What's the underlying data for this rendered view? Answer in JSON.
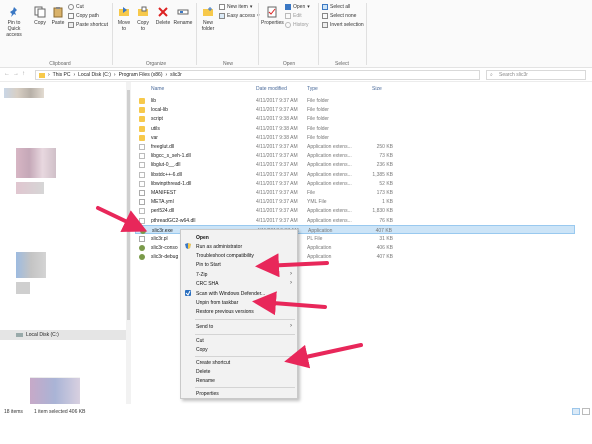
{
  "ribbon": {
    "clipboard": {
      "group_label": "Clipboard",
      "pin_label": "Pin to Quick access",
      "copy_label": "Copy",
      "paste_label": "Paste",
      "cut_label": "Cut",
      "copy_path_label": "Copy path",
      "paste_shortcut_label": "Paste shortcut"
    },
    "organize": {
      "group_label": "Organize",
      "move_to_label": "Move to",
      "copy_to_label": "Copy to",
      "delete_label": "Delete",
      "rename_label": "Rename"
    },
    "new": {
      "group_label": "New",
      "new_folder_label": "New folder",
      "new_item_label": "New item",
      "easy_access_label": "Easy access"
    },
    "open": {
      "group_label": "Open",
      "properties_label": "Properties",
      "open_label": "Open",
      "edit_label": "Edit",
      "history_label": "History"
    },
    "select": {
      "group_label": "Select",
      "select_all_label": "Select all",
      "select_none_label": "Select none",
      "invert_label": "Invert selection"
    }
  },
  "address": {
    "path": [
      "This PC",
      "Local Disk (C:)",
      "Program Files (x86)",
      "slic3r"
    ],
    "search_placeholder": "Search slic3r"
  },
  "nav": {
    "selected_label": "Local Disk (C:)"
  },
  "columns": {
    "name": "Name",
    "date": "Date modified",
    "type": "Type",
    "size": "Size"
  },
  "files": [
    {
      "name": "lib",
      "date": "4/11/2017 9:37 AM",
      "type": "File folder",
      "size": "",
      "kind": "folder"
    },
    {
      "name": "local-lib",
      "date": "4/11/2017 9:37 AM",
      "type": "File folder",
      "size": "",
      "kind": "folder"
    },
    {
      "name": "script",
      "date": "4/11/2017 9:38 AM",
      "type": "File folder",
      "size": "",
      "kind": "folder"
    },
    {
      "name": "utils",
      "date": "4/11/2017 9:38 AM",
      "type": "File folder",
      "size": "",
      "kind": "folder"
    },
    {
      "name": "var",
      "date": "4/11/2017 9:38 AM",
      "type": "File folder",
      "size": "",
      "kind": "folder"
    },
    {
      "name": "freeglut.dll",
      "date": "4/11/2017 9:37 AM",
      "type": "Application extens...",
      "size": "250 KB",
      "kind": "dll"
    },
    {
      "name": "libgcc_s_seh-1.dll",
      "date": "4/11/2017 9:37 AM",
      "type": "Application extens...",
      "size": "73 KB",
      "kind": "dll"
    },
    {
      "name": "libglut-0__.dll",
      "date": "4/11/2017 9:37 AM",
      "type": "Application extens...",
      "size": "236 KB",
      "kind": "dll"
    },
    {
      "name": "libstdc++-6.dll",
      "date": "4/11/2017 9:37 AM",
      "type": "Application extens...",
      "size": "1,385 KB",
      "kind": "dll"
    },
    {
      "name": "libwinpthread-1.dll",
      "date": "4/11/2017 9:37 AM",
      "type": "Application extens...",
      "size": "52 KB",
      "kind": "dll"
    },
    {
      "name": "MANIFEST",
      "date": "4/11/2017 9:37 AM",
      "type": "File",
      "size": "173 KB",
      "kind": "txt"
    },
    {
      "name": "META.yml",
      "date": "4/11/2017 9:37 AM",
      "type": "YML File",
      "size": "1 KB",
      "kind": "txt"
    },
    {
      "name": "perl524.dll",
      "date": "4/11/2017 9:37 AM",
      "type": "Application extens...",
      "size": "1,830 KB",
      "kind": "dll"
    },
    {
      "name": "pthreadGC2-w64.dll",
      "date": "4/11/2017 9:37 AM",
      "type": "Application extens...",
      "size": "76 KB",
      "kind": "dll"
    },
    {
      "name": "slic3r.exe",
      "date": "4/11/2017 9:37 AM",
      "type": "Application",
      "size": "407 KB",
      "kind": "exe"
    },
    {
      "name": "slic3r.pl",
      "date": "",
      "type": "PL File",
      "size": "31 KB",
      "kind": "txt"
    },
    {
      "name": "slic3r-conso",
      "date": "",
      "type": "Application",
      "size": "406 KB",
      "kind": "exe"
    },
    {
      "name": "slic3r-debug",
      "date": "",
      "type": "Application",
      "size": "407 KB",
      "kind": "exe"
    }
  ],
  "context_menu": {
    "open": "Open",
    "run_admin": "Run as administrator",
    "troubleshoot": "Troubleshoot compatibility",
    "pin_start": "Pin to Start",
    "sevenzip": "7-Zip",
    "crc_sha": "CRC SHA",
    "scan_defender": "Scan with Windows Defender...",
    "unpin_taskbar": "Unpin from taskbar",
    "restore_versions": "Restore previous versions",
    "send_to": "Send to",
    "cut": "Cut",
    "copy": "Copy",
    "create_shortcut": "Create shortcut",
    "delete": "Delete",
    "rename": "Rename",
    "properties": "Properties"
  },
  "status": {
    "item_count": "18 items",
    "selection": "1 item selected 406 KB"
  },
  "colors": {
    "arrow": "#e8275a",
    "selection": "#cce4f7",
    "folder": "#f7c94b"
  }
}
